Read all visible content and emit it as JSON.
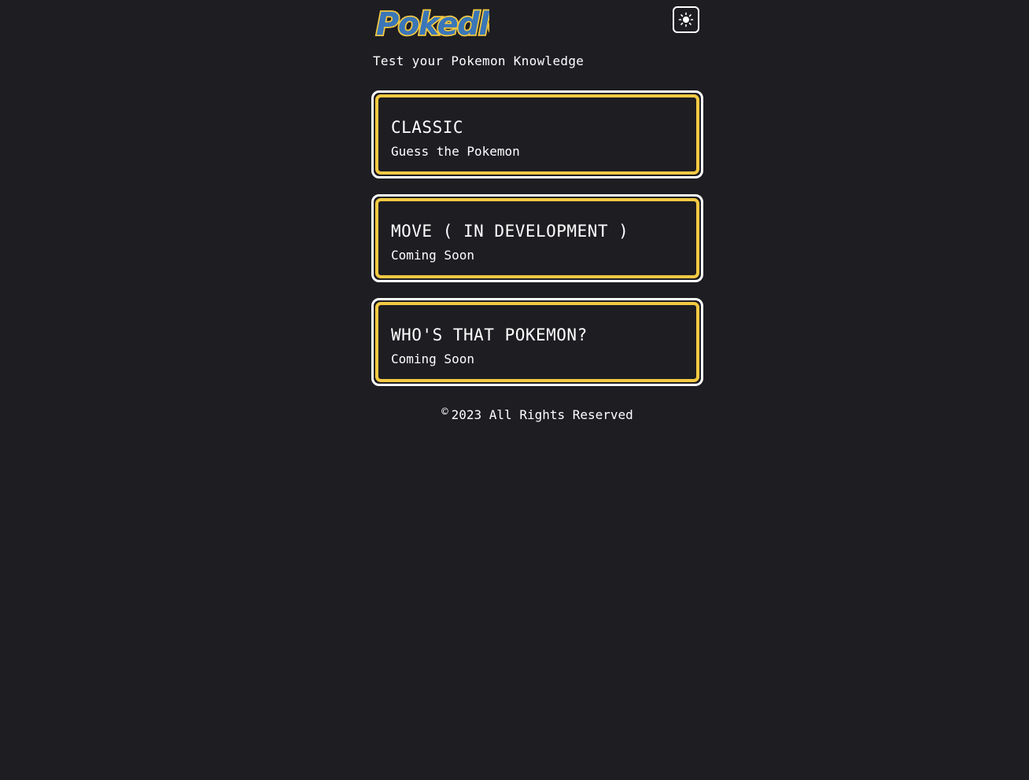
{
  "header": {
    "logo_text": "Pokedle",
    "theme_toggle_icon": "sun-icon"
  },
  "tagline": "Test your Pokemon Knowledge",
  "modes": [
    {
      "title": "CLASSIC",
      "subtitle": "Guess the Pokemon"
    },
    {
      "title": "MOVE ( IN DEVELOPMENT )",
      "subtitle": "Coming Soon"
    },
    {
      "title": "WHO'S THAT POKEMON?",
      "subtitle": "Coming Soon"
    }
  ],
  "footer": {
    "symbol": "©",
    "text": "2023 All Rights Reserved"
  },
  "colors": {
    "background": "#1e1d22",
    "accent": "#f3c943",
    "logo_fill": "#3a76b8",
    "text": "#ffffff"
  }
}
